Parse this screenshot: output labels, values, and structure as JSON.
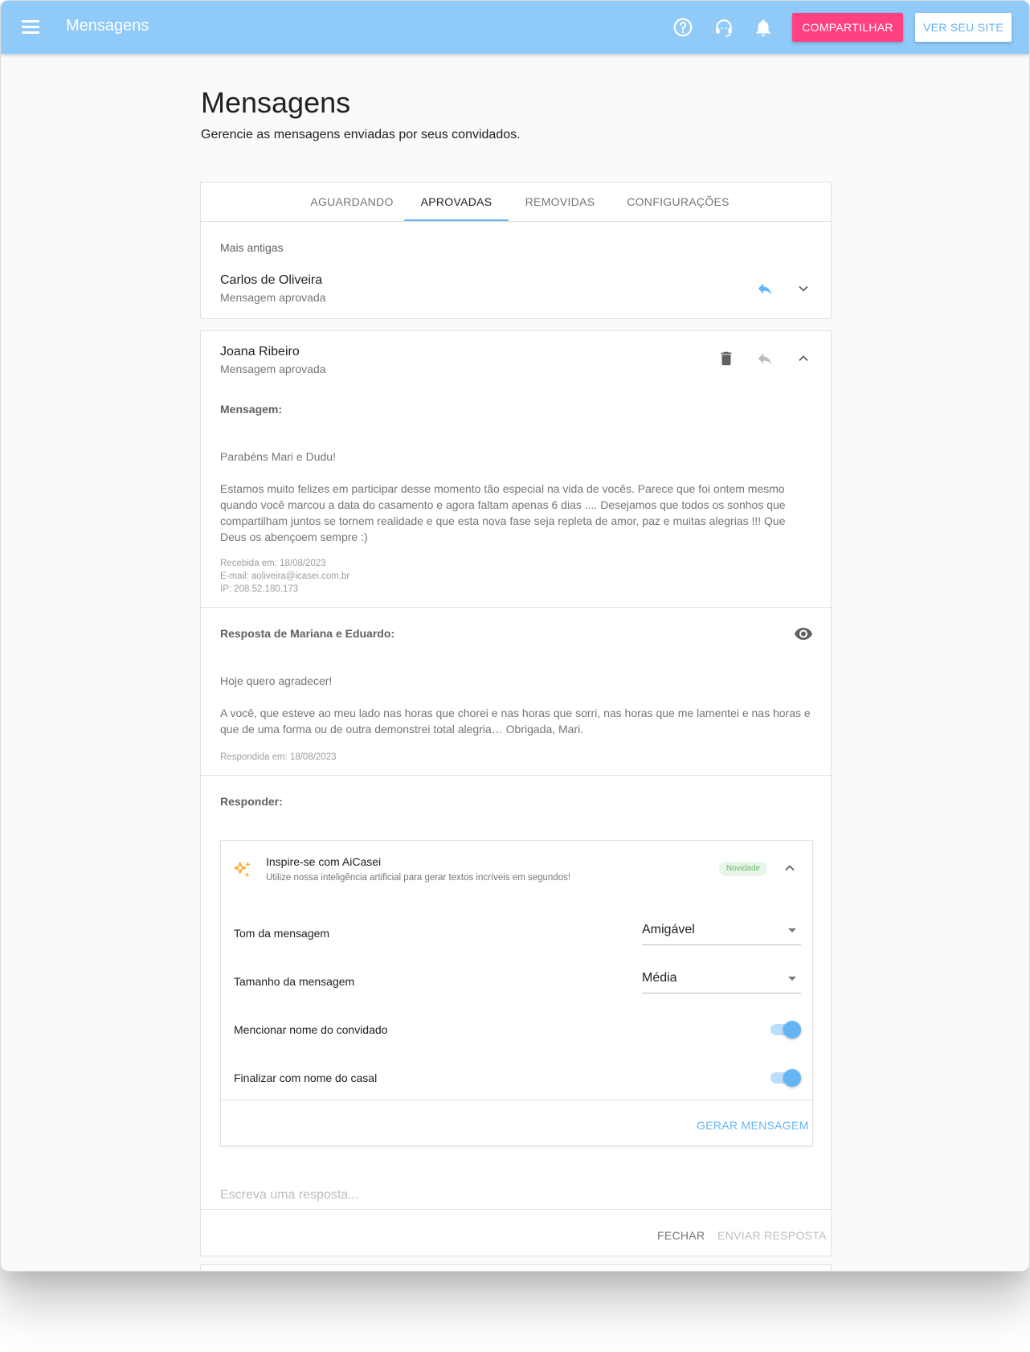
{
  "topbar": {
    "title": "Mensagens",
    "share_label": "COMPARTILHAR",
    "site_label": "VER SEU SITE"
  },
  "page": {
    "title": "Mensagens",
    "subtitle": "Gerencie as mensagens enviadas por seus convidados."
  },
  "tabs": [
    {
      "label": "AGUARDANDO",
      "active": false
    },
    {
      "label": "APROVADAS",
      "active": true
    },
    {
      "label": "REMOVIDAS",
      "active": false
    },
    {
      "label": "CONFIGURAÇÕES",
      "active": false
    }
  ],
  "sort_label": "Mais antigas",
  "messages": [
    {
      "name": "Carlos de Oliveira",
      "status": "Mensagem aprovada"
    },
    {
      "name": "Joana Ribeiro",
      "status": "Mensagem aprovada",
      "message_label": "Mensagem:",
      "greeting": "Parabéns Mari e Dudu!",
      "body": "Estamos muito felizes em participar desse momento tão especial na vida de vocês. Parece que foi ontem mesmo quando você marcou a data do casamento e agora faltam apenas 6 dias .... Desejamos que todos os sonhos que compartilham juntos se tornem realidade e que esta nova fase seja repleta de amor, paz e muitas alegrias !!! Que Deus os abençoem sempre :)",
      "received": "Recebida em: 18/08/2023",
      "email": "E-mail: aoliveira@icasei.com.br",
      "ip": "IP: 208.52.180.173",
      "reply_label": "Resposta de Mariana e Eduardo:",
      "reply_greeting": "Hoje quero agradecer!",
      "reply_body": "A você, que esteve ao meu lado nas horas que chorei e nas horas que sorri, nas horas que me lamentei e nas horas e que de uma forma ou de outra demonstrei total alegria… Obrigada, Mari.",
      "replied": "Respondida em: 18/08/2023",
      "respond_label": "Responder:"
    }
  ],
  "ai": {
    "title": "Inspire-se com AiCasei",
    "subtitle": "Utilize nossa inteligência artificial para gerar textos incríveis em segundos!",
    "badge": "Novidade",
    "tone_label": "Tom da mensagem",
    "tone_value": "Amigável",
    "size_label": "Tamanho da mensagem",
    "size_value": "Média",
    "mention_label": "Mencionar nome do convidado",
    "mention_on": true,
    "finish_label": "Finalizar com nome do casal",
    "finish_on": true,
    "generate_label": "GERAR MENSAGEM"
  },
  "reply": {
    "placeholder": "Escreva uma resposta...",
    "close_label": "FECHAR",
    "send_label": "ENVIAR RESPOSTA"
  },
  "colors": {
    "topbar": "#90caf9",
    "accent_pink": "#ff4081",
    "accent_blue": "#64b5f6",
    "badge_green": "#66bb6a",
    "sparkle": "#ffa726"
  },
  "icons": [
    "menu-icon",
    "help-icon",
    "support-icon",
    "bell-icon",
    "reply-icon",
    "chevron-down-icon",
    "delete-icon",
    "chevron-up-icon",
    "eye-icon",
    "sparkle-icon"
  ]
}
